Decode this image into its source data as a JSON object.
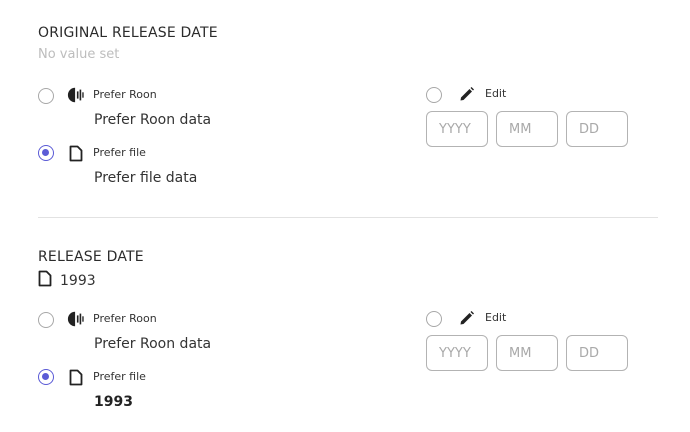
{
  "original_release_date": {
    "title": "ORIGINAL RELEASE DATE",
    "current_value": "No value set",
    "option_roon": {
      "label": "Prefer Roon",
      "data": "Prefer Roon data",
      "selected": false
    },
    "option_file": {
      "label": "Prefer file",
      "data": "Prefer file data",
      "selected": true
    },
    "option_edit": {
      "label": "Edit",
      "selected": false
    },
    "date_placeholders": {
      "year": "YYYY",
      "month": "MM",
      "day": "DD"
    }
  },
  "release_date": {
    "title": "RELEASE DATE",
    "current_value": "1993",
    "option_roon": {
      "label": "Prefer Roon",
      "data": "Prefer Roon data",
      "selected": false
    },
    "option_file": {
      "label": "Prefer file",
      "data": "1993",
      "selected": true
    },
    "option_edit": {
      "label": "Edit",
      "selected": false
    },
    "date_placeholders": {
      "year": "YYYY",
      "month": "MM",
      "day": "DD"
    }
  },
  "colors": {
    "accent": "#5b5bd6",
    "muted": "#bdbdbd",
    "divider": "#e2e2e2"
  },
  "icons": {
    "roon": "roon-logo-icon",
    "file": "file-icon",
    "edit": "pencil-icon"
  }
}
